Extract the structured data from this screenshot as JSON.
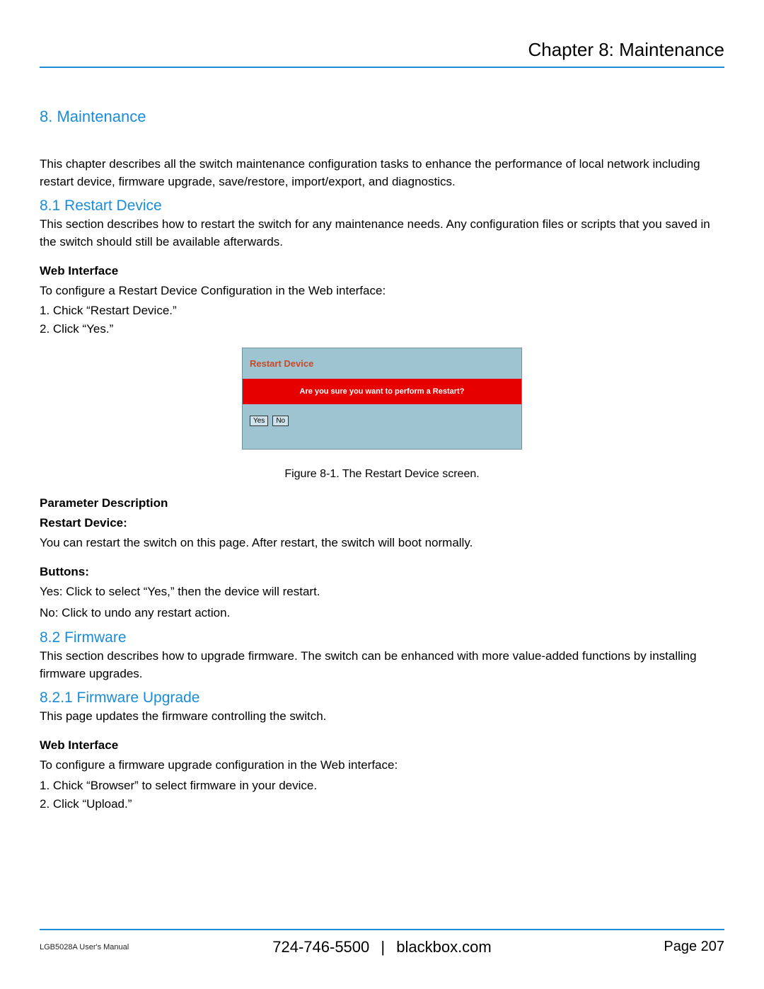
{
  "header": {
    "chapter_title": "Chapter 8: Maintenance"
  },
  "section8": {
    "heading": "8. Maintenance",
    "intro": "This chapter describes all the switch maintenance configuration tasks to enhance the performance of local network including restart device, firmware upgrade, save/restore, import/export, and diagnostics."
  },
  "section8_1": {
    "heading": "8.1 Restart Device",
    "intro": "This section describes how to restart the switch for any maintenance needs. Any configuration files or scripts that you saved in the switch should still be available afterwards.",
    "web_interface_label": "Web Interface",
    "web_interface_intro": "To configure a Restart Device Configuration in the Web interface:",
    "steps": [
      "1. Chick “Restart Device.”",
      "2. Click “Yes.”"
    ],
    "figure": {
      "panel_title": "Restart Device",
      "prompt": "Are you sure you want to perform a Restart?",
      "yes_label": "Yes",
      "no_label": "No",
      "caption": "Figure 8-1. The Restart Device screen."
    },
    "param_desc_label": "Parameter Description",
    "restart_device_label": "Restart Device:",
    "restart_device_text": "You can restart the switch on this page. After restart, the switch will boot normally.",
    "buttons_label": "Buttons:",
    "yes_desc": "Yes: Click to select “Yes,” then the device will restart.",
    "no_desc": "No: Click to undo any restart action."
  },
  "section8_2": {
    "heading": "8.2 Firmware",
    "intro": "This section describes how to upgrade firmware. The switch can be enhanced with more value-added functions by installing firmware upgrades."
  },
  "section8_2_1": {
    "heading": "8.2.1 Firmware Upgrade",
    "intro": "This page updates the firmware controlling the switch.",
    "web_interface_label": "Web Interface",
    "web_interface_intro": "To configure a firmware upgrade configuration in the Web interface:",
    "steps": [
      "1. Chick “Browser” to select firmware in your device.",
      "2. Click “Upload.”"
    ]
  },
  "footer": {
    "manual": "LGB5028A User's Manual",
    "phone": "724-746-5500",
    "separator": "|",
    "site": "blackbox.com",
    "page_label": "Page 207"
  }
}
